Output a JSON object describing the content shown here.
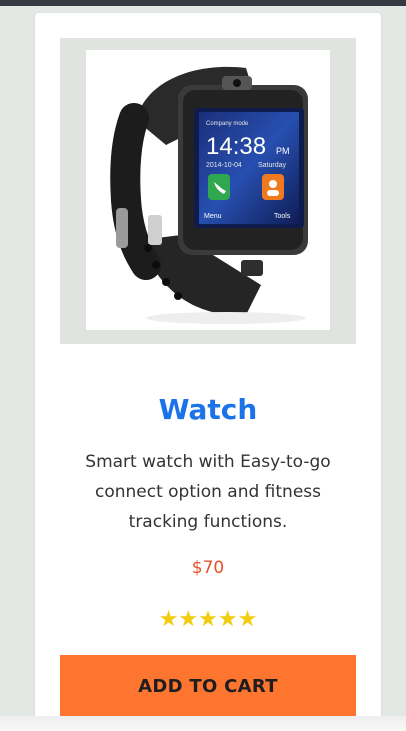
{
  "product": {
    "title": "Watch",
    "description": "Smart watch with Easy-to-go connect option and fitness tracking functions.",
    "price": "$70",
    "rating_stars": "★★★★★",
    "rating": 5,
    "rating_max": 5,
    "button_label": "ADD TO CART",
    "image_icon": "smartwatch-image",
    "watch_screen": {
      "mode": "Company mode",
      "time": "14:38",
      "ampm": "PM",
      "date": "2014-10-04",
      "day": "Saturday",
      "menu": "Menu",
      "tools": "Tools"
    }
  },
  "colors": {
    "title": "#1a73e8",
    "price": "#e4512b",
    "stars": "#f2cc0f",
    "button": "#fe7530",
    "page_bg": "#e4e8e4"
  }
}
